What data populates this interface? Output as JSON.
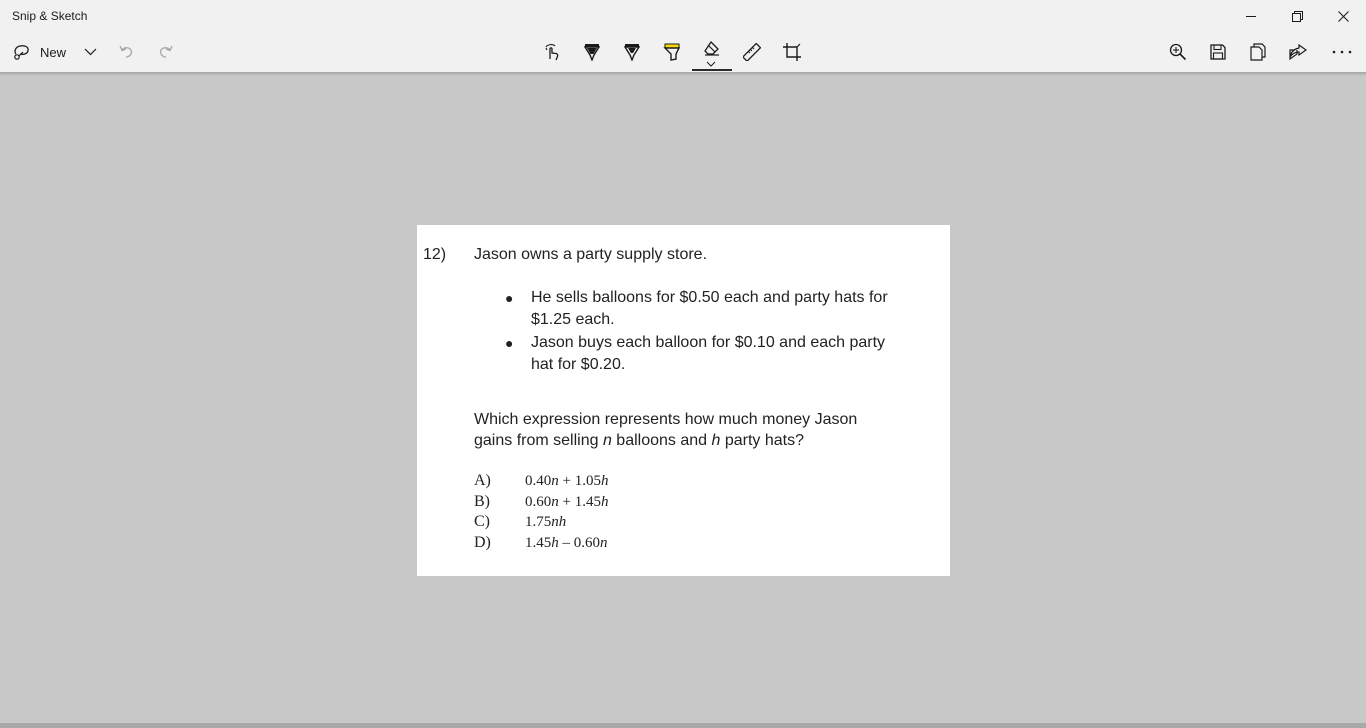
{
  "window": {
    "title": "Snip & Sketch",
    "controls": [
      "minimize",
      "restore",
      "close"
    ]
  },
  "toolbar": {
    "new_label": "New",
    "left_icons": [
      "snip-icon",
      "chevron-down-icon",
      "undo-icon",
      "redo-icon"
    ],
    "center_tools": [
      "touch-writing-icon",
      "ballpoint-pen-icon",
      "pencil-icon",
      "highlighter-icon",
      "eraser-icon",
      "ruler-icon",
      "crop-icon"
    ],
    "right_icons": [
      "zoom-in-icon",
      "save-icon",
      "copy-icon",
      "share-icon",
      "more-icon"
    ],
    "active_tool": "eraser",
    "highlighter_color": "#f5d90a"
  },
  "colors": {
    "canvas_background": "#c8c8c8",
    "chrome_background": "#f1f1f1",
    "document_background": "#ffffff"
  },
  "document": {
    "number": "12)",
    "stem": "Jason owns a party supply store.",
    "bullets": [
      [
        "He sells balloons for $0.50 each and party hats for",
        "$1.25 each."
      ],
      [
        "Jason buys each balloon for $0.10 and each party",
        "hat for $0.20."
      ]
    ],
    "question": {
      "line1": "Which expression represents how much money Jason",
      "line2_a": "gains from selling ",
      "var_n": "n",
      "line2_b": " balloons and ",
      "var_h": "h",
      "line2_c": " party hats?"
    },
    "choices": [
      {
        "letter": "A)",
        "parts": [
          "0.40",
          "n",
          " + 1.05",
          "h"
        ]
      },
      {
        "letter": "B)",
        "parts": [
          "0.60",
          "n",
          " + 1.45",
          "h"
        ]
      },
      {
        "letter": "C)",
        "parts": [
          "1.75",
          "nh",
          "",
          ""
        ]
      },
      {
        "letter": "D)",
        "parts": [
          "1.45",
          "h",
          " – 0.60",
          "n"
        ]
      }
    ]
  }
}
